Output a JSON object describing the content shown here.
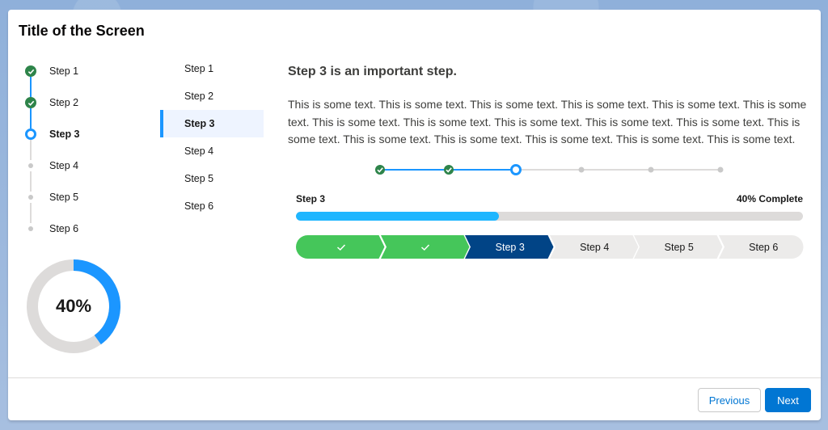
{
  "screen": {
    "title": "Title of the Screen"
  },
  "vertical_path": {
    "steps": [
      {
        "label": "Step 1",
        "status": "complete"
      },
      {
        "label": "Step 2",
        "status": "complete"
      },
      {
        "label": "Step 3",
        "status": "current"
      },
      {
        "label": "Step 4",
        "status": "incomplete"
      },
      {
        "label": "Step 5",
        "status": "incomplete"
      },
      {
        "label": "Step 6",
        "status": "incomplete"
      }
    ]
  },
  "ring": {
    "value_text": "40%",
    "value": 0.4,
    "fill_color": "#1b96ff",
    "track_color": "#dddbda"
  },
  "vertical_nav": {
    "items": [
      "Step 1",
      "Step 2",
      "Step 3",
      "Step 4",
      "Step 5",
      "Step 6"
    ],
    "active_index": 2
  },
  "main": {
    "heading": "Step 3 is an important step.",
    "body": "This is some text. This is some text. This is some text. This is some text. This is some text. This is some text. This is some text. This is some text. This is some text. This is some text. This is some text. This is some text. This is some text. This is some text. This is some text. This is some text. This is some text."
  },
  "dot_path": {
    "steps": 6,
    "current_index": 2
  },
  "progress_bar": {
    "step_label": "Step 3",
    "complete_label": "40% Complete",
    "value": 0.4
  },
  "chevron_path": {
    "items": [
      {
        "label": "",
        "status": "complete",
        "icon": "check-icon"
      },
      {
        "label": "",
        "status": "complete",
        "icon": "check-icon"
      },
      {
        "label": "Step 3",
        "status": "current"
      },
      {
        "label": "Step 4",
        "status": "incomplete"
      },
      {
        "label": "Step 5",
        "status": "incomplete"
      },
      {
        "label": "Step 6",
        "status": "incomplete"
      }
    ]
  },
  "footer": {
    "previous_label": "Previous",
    "next_label": "Next"
  },
  "colors": {
    "complete": "#2e844a",
    "chevron_complete": "#45c65a",
    "current": "#1b96ff",
    "chevron_current": "#014486",
    "incomplete": "#c9c9c9",
    "chevron_incomplete": "#ecebea",
    "brand": "#0176d3"
  }
}
